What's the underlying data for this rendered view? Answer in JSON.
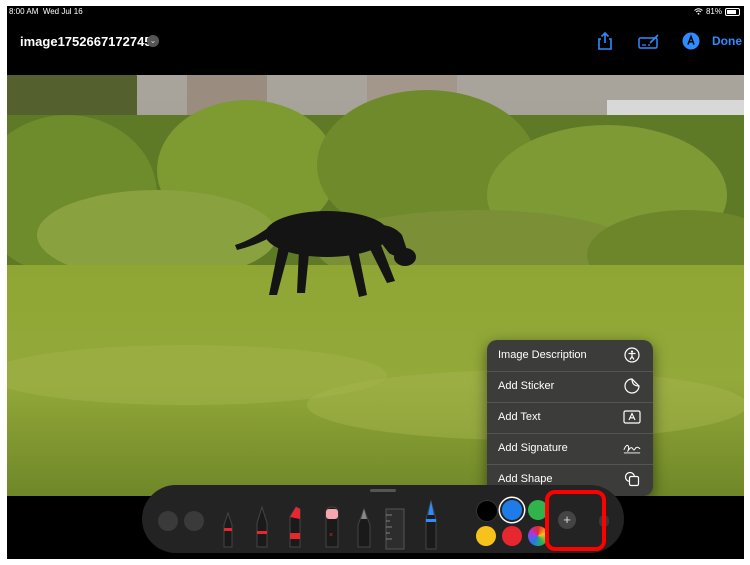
{
  "status_bar": {
    "time": "8:00 AM",
    "date": "Wed Jul 16",
    "battery": "81%"
  },
  "header": {
    "title": "image1752667172745",
    "done_label": "Done"
  },
  "menu": {
    "items": [
      {
        "label": "Image Description",
        "icon": "accessibility-icon"
      },
      {
        "label": "Add Sticker",
        "icon": "sticker-icon"
      },
      {
        "label": "Add Text",
        "icon": "text-box-icon"
      },
      {
        "label": "Add Signature",
        "icon": "signature-icon"
      },
      {
        "label": "Add Shape",
        "icon": "shape-icon"
      }
    ]
  },
  "colors": {
    "accent": "#2f8cff",
    "swatches": [
      "#000000",
      "#1f7be8",
      "#2fb34a",
      "#f7c31b",
      "#e8262f",
      "rainbow"
    ],
    "highlight": "#ff0000"
  },
  "toolbar": {
    "tools": [
      "pen",
      "pen-red",
      "marker-red",
      "eraser",
      "pencil",
      "ruler",
      "fountain-pen-blue"
    ]
  }
}
